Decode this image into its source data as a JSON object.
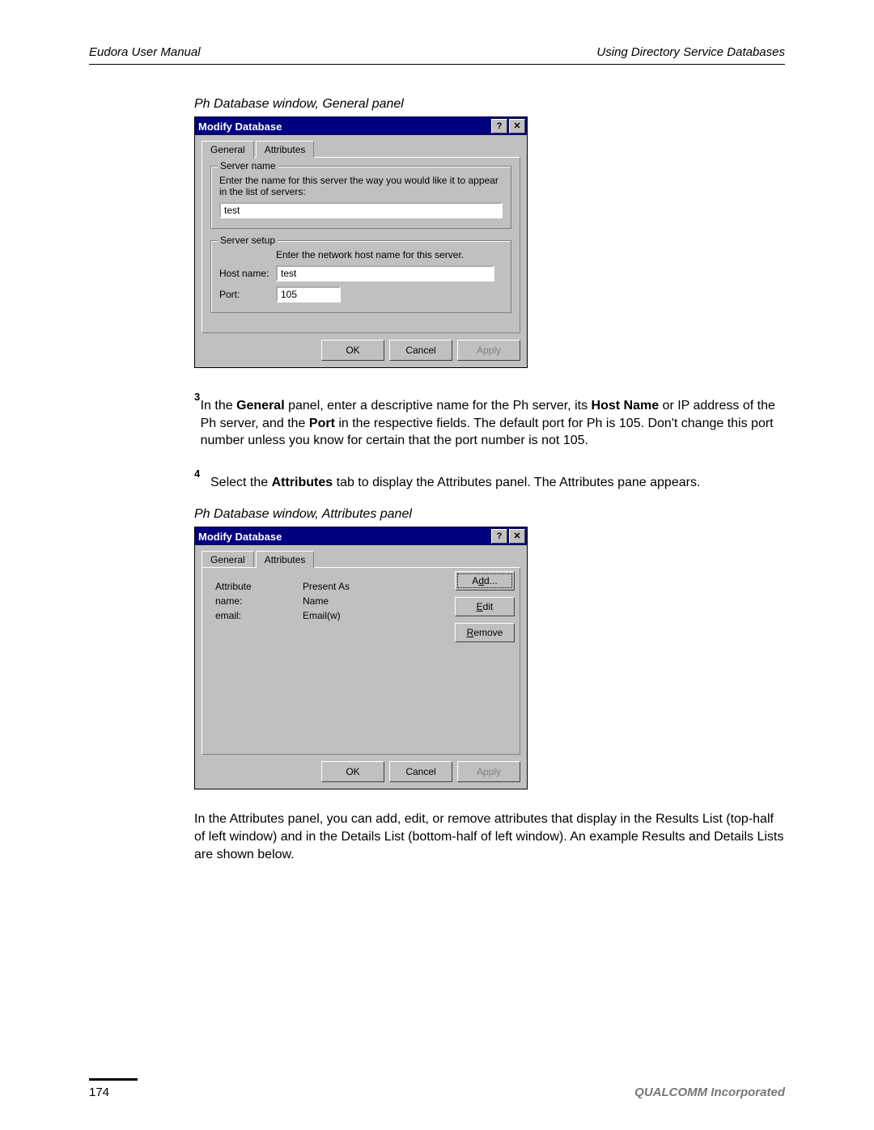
{
  "header": {
    "left": "Eudora User Manual",
    "right": "Using Directory Service Databases"
  },
  "caption1": "Ph Database window, General panel",
  "dialog1": {
    "title": "Modify Database",
    "help": "?",
    "close": "✕",
    "tabs": {
      "general": "General",
      "attributes": "Attributes"
    },
    "group_servername": {
      "label": "Server name",
      "hint": "Enter the name for this server the way you would like it to appear in the list of servers:",
      "value": "test"
    },
    "group_setup": {
      "label": "Server setup",
      "hint": "Enter the network host name for this server.",
      "host_label": "Host name:",
      "host_value": "test",
      "port_label": "Port:",
      "port_value": "105"
    },
    "buttons": {
      "ok": "OK",
      "cancel": "Cancel",
      "apply": "Apply"
    }
  },
  "step3": {
    "num": "3",
    "p1a": "In the ",
    "b1": "General",
    "p1b": " panel, enter a descriptive name for the Ph server, its ",
    "b2": "Host Name",
    "p1c": " or IP address of the Ph server, and the ",
    "b3": "Port",
    "p1d": " in the respective fields. The default port for Ph is 105. Don't change this port number unless you know for certain that the port number is not 105."
  },
  "step4": {
    "num": "4",
    "p1a": "Select the ",
    "b1": "Attributes",
    "p1b": " tab to display the Attributes panel. The Attributes pane appears."
  },
  "caption2": "Ph Database window, Attributes panel",
  "dialog2": {
    "title": "Modify Database",
    "help": "?",
    "close": "✕",
    "tabs": {
      "general": "General",
      "attributes": "Attributes"
    },
    "columns": {
      "attr": "Attribute",
      "present": "Present As"
    },
    "rows": [
      {
        "attr": "name:",
        "present": "Name"
      },
      {
        "attr": "email:",
        "present": "Email(w)"
      }
    ],
    "sidebuttons": {
      "add_pre": "A",
      "add_u": "d",
      "add_post": "d...",
      "edit_u": "E",
      "edit_post": "dit",
      "remove_u": "R",
      "remove_post": "emove"
    },
    "buttons": {
      "ok": "OK",
      "cancel": "Cancel",
      "apply": "Apply"
    }
  },
  "aftertext": "In the Attributes panel, you can add, edit, or remove attributes that display in the Results List (top-half of left window) and in the Details List (bottom-half of left window). An example Results and Details Lists are shown below.",
  "footer": {
    "page": "174",
    "company": "QUALCOMM Incorporated"
  }
}
